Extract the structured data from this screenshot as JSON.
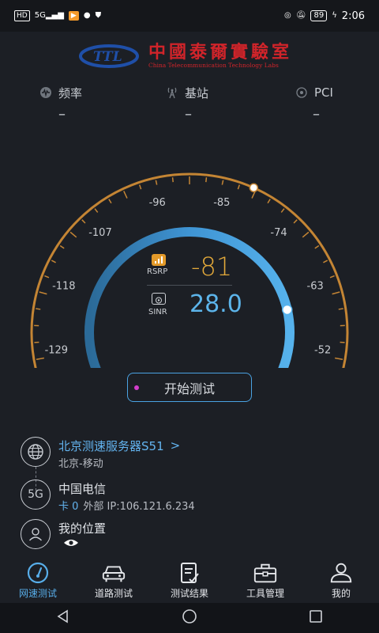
{
  "status_bar": {
    "left_icons": [
      "hd-icon",
      "5g-signal-icon",
      "app-notification-icon",
      "chat-icon",
      "shield-icon"
    ],
    "hd": "HD",
    "signal": "5G",
    "battery": "89",
    "time": "2:06"
  },
  "logo": {
    "mark": "TTL",
    "title": "中國泰爾實驗室",
    "subtitle": "China Telecommunication Technology Labs"
  },
  "metrics": [
    {
      "label": "频率",
      "value": "–",
      "icon": "frequency-icon"
    },
    {
      "label": "基站",
      "value": "–",
      "icon": "tower-icon"
    },
    {
      "label": "PCI",
      "value": "–",
      "icon": "pci-icon"
    }
  ],
  "gauge": {
    "min": -140,
    "max": -41,
    "ticks": [
      "-140",
      "-129",
      "-118",
      "-107",
      "-96",
      "-85",
      "-74",
      "-63",
      "-52",
      "-41"
    ],
    "outer_color": "#c48534",
    "inner_color": "#4aa3e3",
    "rsrp_label": "RSRP",
    "rsrp_value": "-81",
    "sinr_label": "SINR",
    "sinr_value": "28.0",
    "rsrp_color": "#e3a93a",
    "sinr_color": "#5cb4ea"
  },
  "start_button": "开始测试",
  "server": {
    "name": "北京测速服务器S51",
    "chevron": ">",
    "location": "北京-移动"
  },
  "network": {
    "badge": "5G",
    "carrier": "中国电信",
    "card": "卡 0",
    "ip": "外部 IP:106.121.6.234"
  },
  "position": {
    "title": "我的位置"
  },
  "tabs": [
    {
      "label": "网速测试",
      "icon": "speed-test-icon",
      "active": true
    },
    {
      "label": "道路测试",
      "icon": "car-icon",
      "active": false
    },
    {
      "label": "测试结果",
      "icon": "results-icon",
      "active": false
    },
    {
      "label": "工具管理",
      "icon": "toolbox-icon",
      "active": false
    },
    {
      "label": "我的",
      "icon": "user-icon",
      "active": false
    }
  ],
  "nav": [
    "back-icon",
    "home-icon",
    "recents-icon"
  ]
}
